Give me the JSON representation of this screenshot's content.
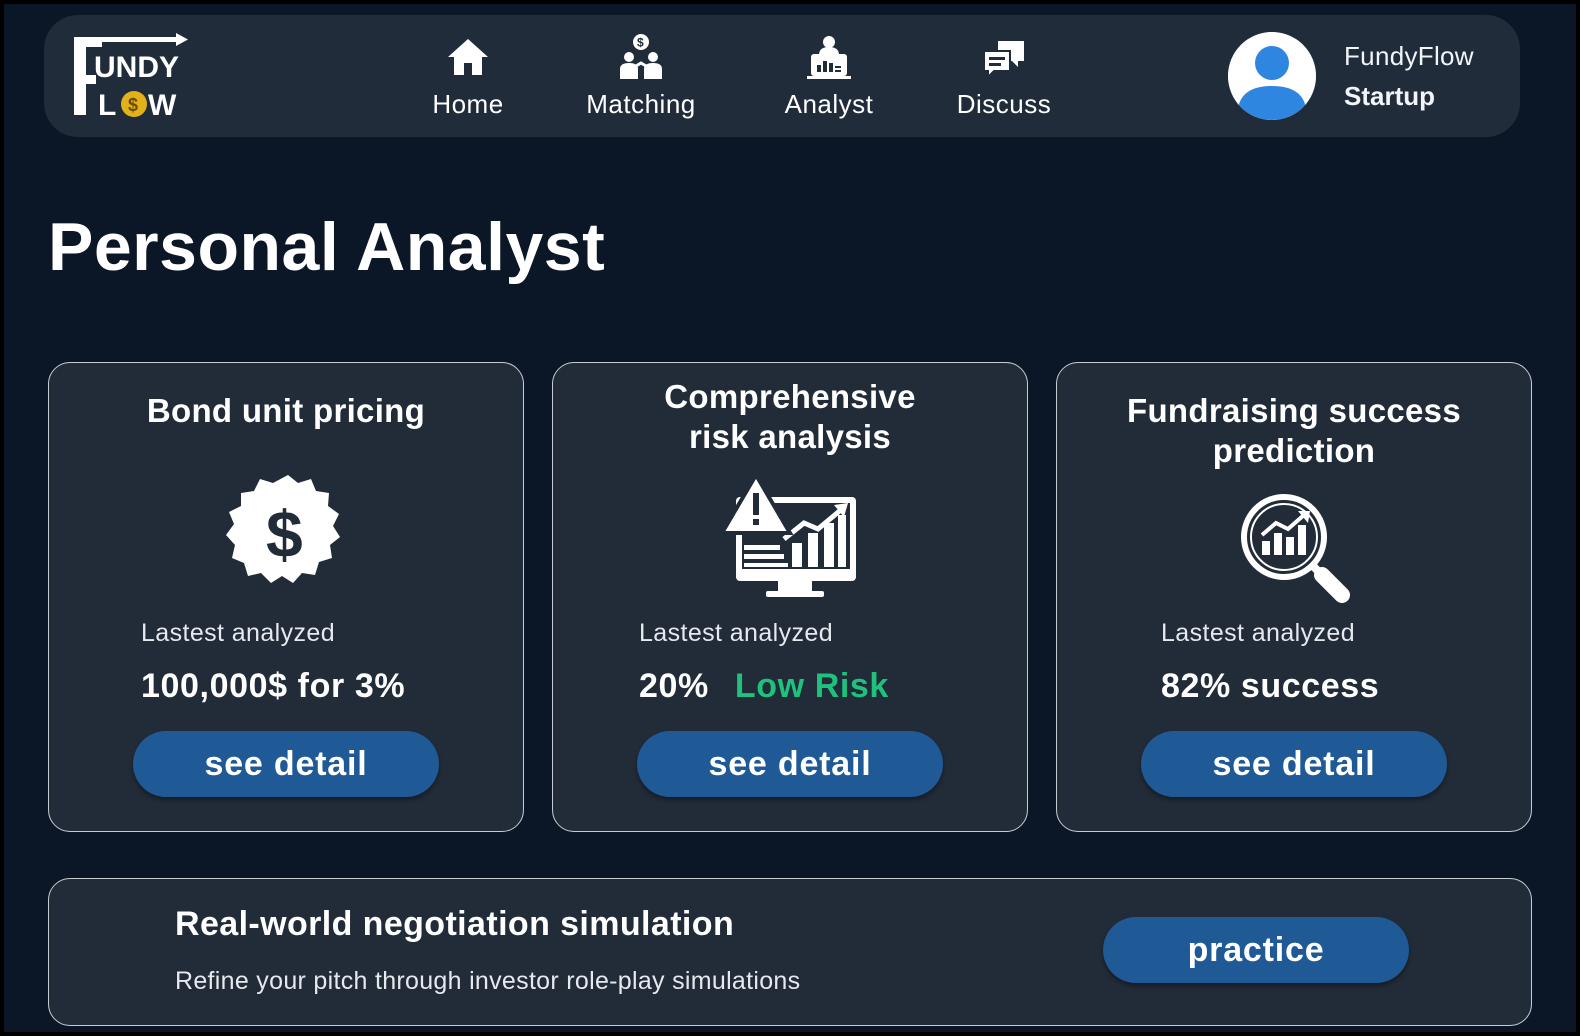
{
  "brand": {
    "logo_text_top": "FUNDY",
    "logo_text_bottom": "LOW",
    "logo_initial": "F"
  },
  "nav": {
    "items": [
      {
        "label": "Home",
        "icon": "home-icon"
      },
      {
        "label": "Matching",
        "icon": "matching-icon"
      },
      {
        "label": "Analyst",
        "icon": "analyst-icon"
      },
      {
        "label": "Discuss",
        "icon": "discuss-icon"
      }
    ]
  },
  "user": {
    "name": "FundyFlow",
    "role": "Startup"
  },
  "page": {
    "title": "Personal Analyst"
  },
  "cards": [
    {
      "title": "Bond unit pricing",
      "icon": "dollar-badge-icon",
      "latest_label": "Lastest analyzed",
      "result": "100,000$ for 3%",
      "button": "see detail"
    },
    {
      "title": "Comprehensive risk analysis",
      "icon": "risk-monitor-icon",
      "latest_label": "Lastest analyzed",
      "result_value": "20%",
      "result_level": "Low Risk",
      "button": "see detail"
    },
    {
      "title": "Fundraising success prediction",
      "icon": "magnifier-chart-icon",
      "latest_label": "Lastest analyzed",
      "result": "82% success",
      "button": "see detail"
    }
  ],
  "simulation": {
    "title": "Real-world negotiation simulation",
    "description": "Refine your pitch through investor role-play simulations",
    "button": "practice"
  },
  "colors": {
    "background": "#0b1726",
    "panel": "#222b38",
    "button": "#1f5a96",
    "low_risk": "#1ec27c",
    "avatar": "#2f86e0",
    "logo_coin": "#e3b21b"
  }
}
